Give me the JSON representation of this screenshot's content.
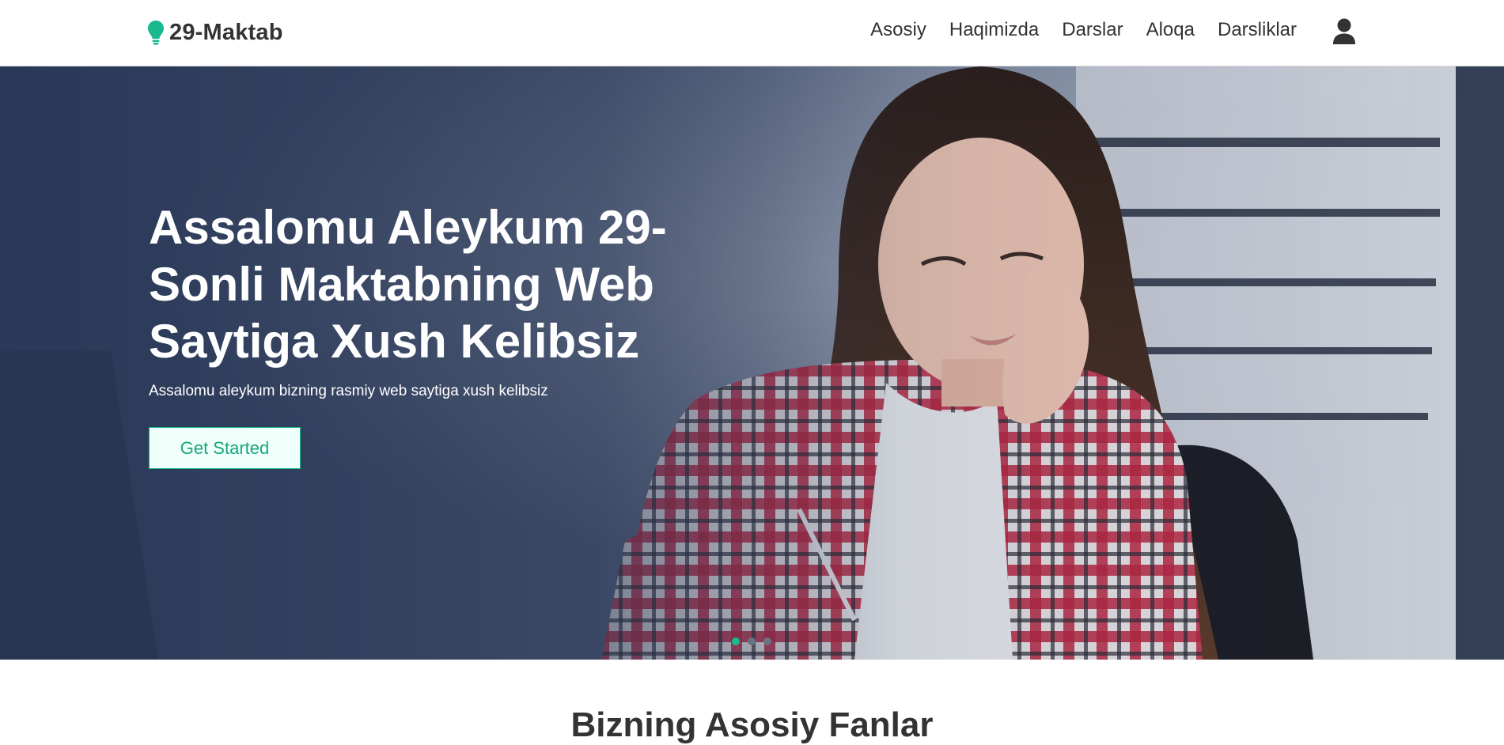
{
  "header": {
    "brand": "29-Maktab",
    "nav": [
      {
        "label": "Asosiy"
      },
      {
        "label": "Haqimizda"
      },
      {
        "label": "Darslar"
      },
      {
        "label": "Aloqa"
      },
      {
        "label": "Darsliklar"
      }
    ],
    "icons": {
      "brand": "lightbulb-icon",
      "user": "user-icon"
    }
  },
  "hero": {
    "title": "Assalomu Aleykum 29-Sonli Maktabning Web Saytiga Xush Kelibsiz",
    "subtitle": "Assalomu aleykum bizning rasmiy web saytiga xush kelibsiz",
    "cta_label": "Get Started",
    "slides_total": 3,
    "active_slide": 1
  },
  "section": {
    "title": "Bizning Asosiy Fanlar"
  },
  "colors": {
    "accent": "#19b98f",
    "text_dark": "#333333",
    "hero_overlay": "#243250"
  }
}
